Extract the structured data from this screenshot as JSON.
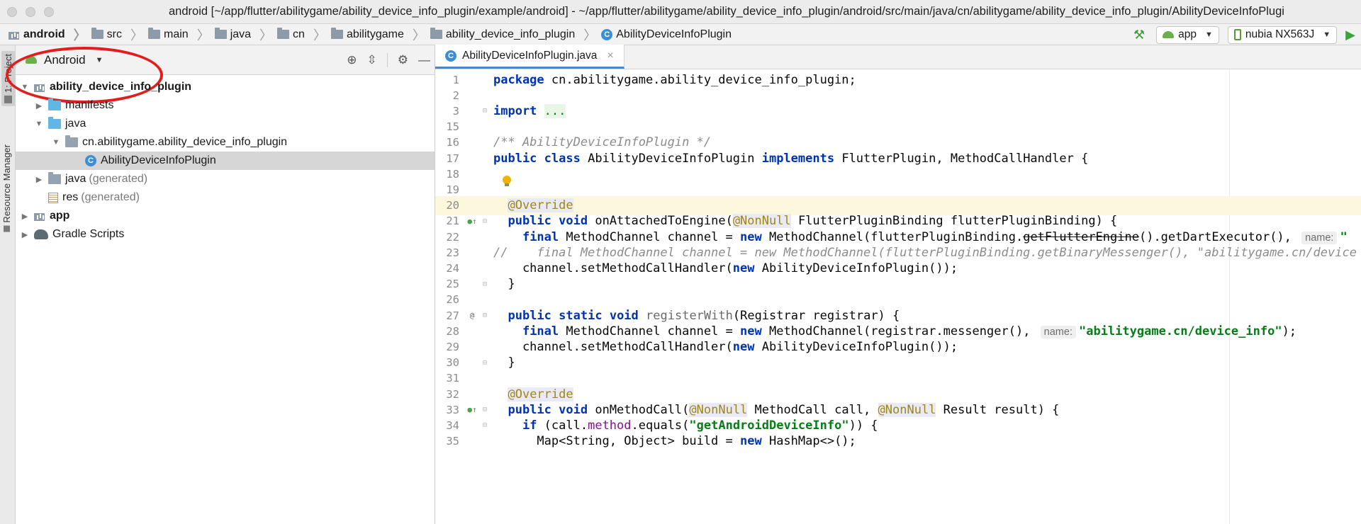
{
  "window": {
    "title": "android [~/app/flutter/abilitygame/ability_device_info_plugin/example/android] - ~/app/flutter/abilitygame/ability_device_info_plugin/android/src/main/java/cn/abilitygame/ability_device_info_plugin/AbilityDeviceInfoPlugi"
  },
  "breadcrumbs": [
    {
      "label": "android",
      "icon": "module-icon"
    },
    {
      "label": "src",
      "icon": "folder-icon"
    },
    {
      "label": "main",
      "icon": "folder-icon"
    },
    {
      "label": "java",
      "icon": "folder-icon"
    },
    {
      "label": "cn",
      "icon": "folder-icon"
    },
    {
      "label": "abilitygame",
      "icon": "folder-icon"
    },
    {
      "label": "ability_device_info_plugin",
      "icon": "folder-icon"
    },
    {
      "label": "AbilityDeviceInfoPlugin",
      "icon": "class-icon"
    }
  ],
  "toolbar": {
    "run_config": "app",
    "device": "nubia NX563J"
  },
  "toolstrip": {
    "project_tab": "1: Project",
    "resource_tab": "Resource Manager"
  },
  "project_panel": {
    "view_mode": "Android",
    "tree": [
      {
        "label": "ability_device_info_plugin",
        "suffix": "",
        "level": 0,
        "arrow": "▼",
        "icon": "module"
      },
      {
        "label": "manifests",
        "suffix": "",
        "level": 1,
        "arrow": "▶",
        "icon": "folder-blue"
      },
      {
        "label": "java",
        "suffix": "",
        "level": 1,
        "arrow": "▼",
        "icon": "folder-blue"
      },
      {
        "label": "cn.abilitygame.ability_device_info_plugin",
        "suffix": "",
        "level": 2,
        "arrow": "▼",
        "icon": "package"
      },
      {
        "label": "AbilityDeviceInfoPlugin",
        "suffix": "",
        "level": 3,
        "arrow": "",
        "icon": "class"
      },
      {
        "label": "java",
        "suffix": "(generated)",
        "level": 1,
        "arrow": "▶",
        "icon": "folder-grey"
      },
      {
        "label": "res",
        "suffix": "(generated)",
        "level": 1,
        "arrow": "",
        "icon": "res"
      },
      {
        "label": "app",
        "suffix": "",
        "level": 0,
        "arrow": "▶",
        "icon": "module"
      },
      {
        "label": "Gradle Scripts",
        "suffix": "",
        "level": 0,
        "arrow": "▶",
        "icon": "gradle"
      }
    ]
  },
  "editor": {
    "tab_label": "AbilityDeviceInfoPlugin.java",
    "lines": [
      {
        "n": "1",
        "code": "package cn.abilitygame.ability_device_info_plugin;"
      },
      {
        "n": "2",
        "code": ""
      },
      {
        "n": "3",
        "code": "import ..."
      },
      {
        "n": "15",
        "code": ""
      },
      {
        "n": "16",
        "code": "/** AbilityDeviceInfoPlugin */"
      },
      {
        "n": "17",
        "code": "public class AbilityDeviceInfoPlugin implements FlutterPlugin, MethodCallHandler {"
      },
      {
        "n": "18",
        "code": ""
      },
      {
        "n": "19",
        "code": ""
      },
      {
        "n": "20",
        "code": "  @Override"
      },
      {
        "n": "21",
        "code": "  public void onAttachedToEngine(@NonNull FlutterPluginBinding flutterPluginBinding) {"
      },
      {
        "n": "22",
        "code": "    final MethodChannel channel = new MethodChannel(flutterPluginBinding.getFlutterEngine().getDartExecutor(), name: \""
      },
      {
        "n": "23",
        "code": "//    final MethodChannel channel = new MethodChannel(flutterPluginBinding.getBinaryMessenger(), \"abilitygame.cn/device"
      },
      {
        "n": "24",
        "code": "    channel.setMethodCallHandler(new AbilityDeviceInfoPlugin());"
      },
      {
        "n": "25",
        "code": "  }"
      },
      {
        "n": "26",
        "code": ""
      },
      {
        "n": "27",
        "code": "  public static void registerWith(Registrar registrar) {"
      },
      {
        "n": "28",
        "code": "    final MethodChannel channel = new MethodChannel(registrar.messenger(), name: \"abilitygame.cn/device_info\");"
      },
      {
        "n": "29",
        "code": "    channel.setMethodCallHandler(new AbilityDeviceInfoPlugin());"
      },
      {
        "n": "30",
        "code": "  }"
      },
      {
        "n": "31",
        "code": ""
      },
      {
        "n": "32",
        "code": "  @Override"
      },
      {
        "n": "33",
        "code": "  public void onMethodCall(@NonNull MethodCall call, @NonNull Result result) {"
      },
      {
        "n": "34",
        "code": "    if (call.method.equals(\"getAndroidDeviceInfo\")) {"
      },
      {
        "n": "35",
        "code": "      Map<String, Object> build = new HashMap<>();"
      }
    ]
  }
}
